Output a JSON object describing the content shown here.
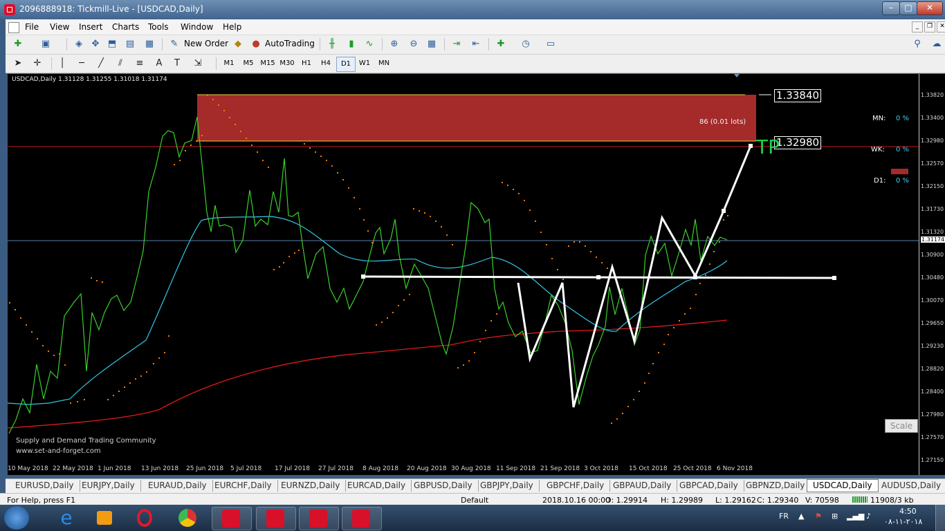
{
  "window": {
    "title": "2096888918: Tickmill-Live - [USDCAD,Daily]"
  },
  "menu": [
    "File",
    "View",
    "Insert",
    "Charts",
    "Tools",
    "Window",
    "Help"
  ],
  "toolbar": {
    "new_order": "New Order",
    "autotrading": "AutoTrading"
  },
  "timeframes": [
    "M1",
    "M5",
    "M15",
    "M30",
    "H1",
    "H4",
    "D1",
    "W1",
    "MN"
  ],
  "active_timeframe": "D1",
  "chart": {
    "header": "USDCAD,Daily  1.31128 1.31255 1.31018 1.31174",
    "price_labels": [
      "1.33820",
      "1.33400",
      "1.32980",
      "1.32570",
      "1.32150",
      "1.31730",
      "1.31320",
      "1.31174",
      "1.30900",
      "1.30480",
      "1.30070",
      "1.29650",
      "1.29230",
      "1.28820",
      "1.28400",
      "1.27980",
      "1.27570",
      "1.27150"
    ],
    "date_labels": [
      "10 May 2018",
      "22 May 2018",
      "1 Jun 2018",
      "13 Jun 2018",
      "25 Jun 2018",
      "5 Jul 2018",
      "17 Jul 2018",
      "27 Jul 2018",
      "8 Aug 2018",
      "20 Aug 2018",
      "30 Aug 2018",
      "11 Sep 2018",
      "21 Sep 2018",
      "3 Oct 2018",
      "15 Oct 2018",
      "25 Oct 2018",
      "6 Nov 2018"
    ],
    "zone_label": "86 (0.01 lots)",
    "level_top": "1.33840",
    "level_tp": "1.32980",
    "tp_text": "TP",
    "stats": [
      {
        "label": "MN:",
        "value": "0 %"
      },
      {
        "label": "WK:",
        "value": "0 %"
      },
      {
        "label": "D1:",
        "value": "0 %"
      }
    ],
    "scale_button": "Scale",
    "comment_line1": "Supply and Demand Trading Community",
    "comment_line2": "www.set-and-forget.com",
    "colors": {
      "price_line": "#39d12a",
      "fast_ma": "#33c7e6",
      "slow_ma": "#e01a1a",
      "sar": "#ff7a00",
      "zone": "#a52a2a",
      "drawing": "#ffffff",
      "tp": "#19d34a"
    }
  },
  "tabs": [
    "EURUSD,Daily",
    "EURJPY,Daily",
    "EURAUD,Daily",
    "EURCHF,Daily",
    "EURNZD,Daily",
    "EURCAD,Daily",
    "GBPUSD,Daily",
    "GBPJPY,Daily",
    "GBPCHF,Daily",
    "GBPAUD,Daily",
    "GBPCAD,Daily",
    "GBPNZD,Daily",
    "USDCAD,Daily",
    "AUDUSD,Daily"
  ],
  "active_tab": "USDCAD,Daily",
  "status": {
    "help": "For Help, press F1",
    "profile": "Default",
    "datetime": "2018.10.16 00:00",
    "open": "O: 1.29914",
    "high": "H: 1.29989",
    "low": "L: 1.29162",
    "close": "C: 1.29340",
    "volume": "V: 70598",
    "traffic": "11908/3 kb"
  },
  "tray": {
    "lang": "FR",
    "time": "4:50",
    "date": "٢٠١٨-١١-٠٨"
  }
}
